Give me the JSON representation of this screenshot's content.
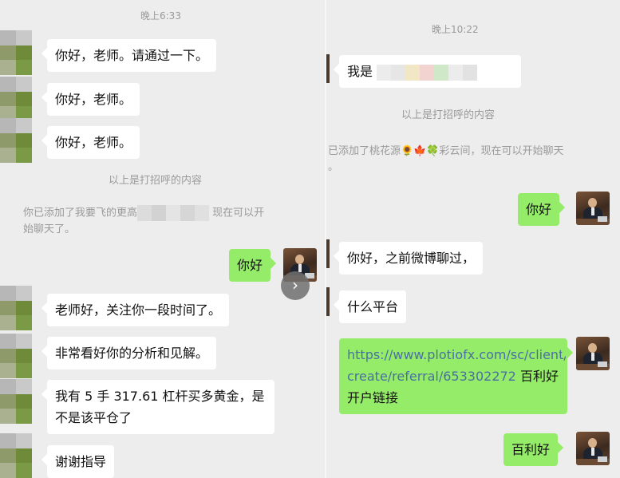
{
  "left": {
    "time": "晚上6:33",
    "messages": [
      "你好，老师。请通过一下。",
      "你好，老师。",
      "你好，老师。"
    ],
    "greeting_notice": "以上是打招呼的内容",
    "added_notice_prefix": "你已添加了我要飞的更高",
    "added_notice_suffix": "现在可以开",
    "added_notice_line2": "始聊天了。",
    "my_reply": "你好",
    "messages2": [
      "老师好，关注你一段时间了。",
      "非常看好你的分析和见解。",
      "我有 5 手 317.61 杠杆买多黄金，是",
      "不是该平仓了",
      "谢谢指导"
    ],
    "scroll_glyph": "›"
  },
  "right": {
    "time": "晚上10:22",
    "first_msg": "我是",
    "greeting_notice": "以上是打招呼的内容",
    "added_notice_line1": "已添加了桃花源🌻🍁🍀彩云间，现在可以开始聊天",
    "added_notice_line2": "。",
    "my_reply1": "你好",
    "msg_weibo": "你好，之前微博聊过，",
    "msg_platform": "什么平台",
    "link_line1": "https://www.plotiofx.com/sc/client/",
    "link_line2": "create/referral/653302272",
    "link_suffix": " 百利好",
    "link_line3": "开户链接",
    "my_reply2": "百利好"
  }
}
